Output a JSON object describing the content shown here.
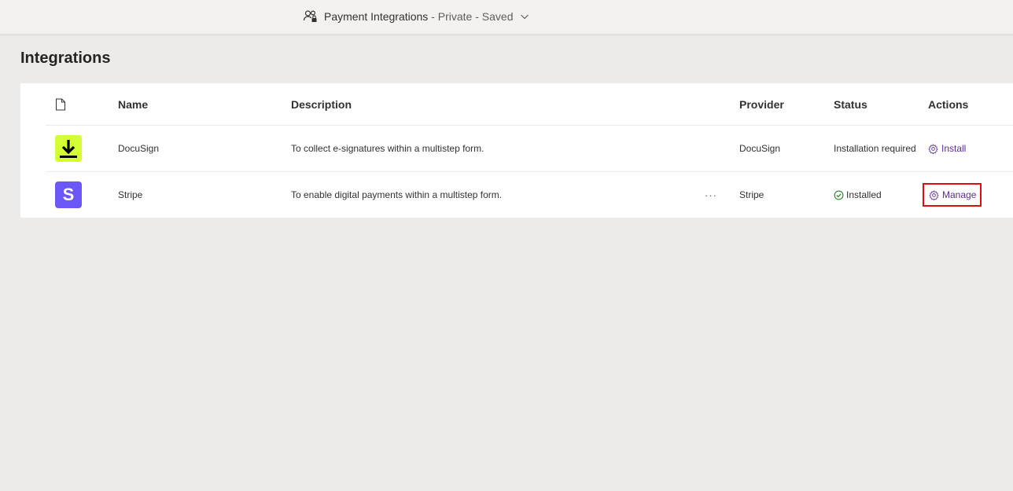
{
  "header": {
    "title": "Payment Integrations",
    "separator1": " - ",
    "privacy": "Private",
    "separator2": " - ",
    "save_state": "Saved",
    "icons": [
      "people-lock-icon",
      "chevron-down-icon"
    ]
  },
  "page": {
    "title": "Integrations"
  },
  "table": {
    "columns": {
      "icon": "file-icon",
      "name": "Name",
      "description": "Description",
      "provider": "Provider",
      "status": "Status",
      "actions": "Actions"
    },
    "rows": [
      {
        "name": "DocuSign",
        "description": "To collect e-signatures within a multistep form.",
        "provider": "DocuSign",
        "status": "Installation required",
        "action": "Install",
        "logo": "download-arrow-icon",
        "logo_color": "#d4ff35"
      },
      {
        "name": "Stripe",
        "description": "To enable digital payments within a multistep form.",
        "more": "···",
        "provider": "Stripe",
        "status": "Installed",
        "action": "Manage",
        "logo": "S",
        "logo_color": "#6b57f5"
      }
    ]
  },
  "colors": {
    "accent": "#5b2d91",
    "success": "#107c10",
    "highlight": "#e00b0b"
  }
}
